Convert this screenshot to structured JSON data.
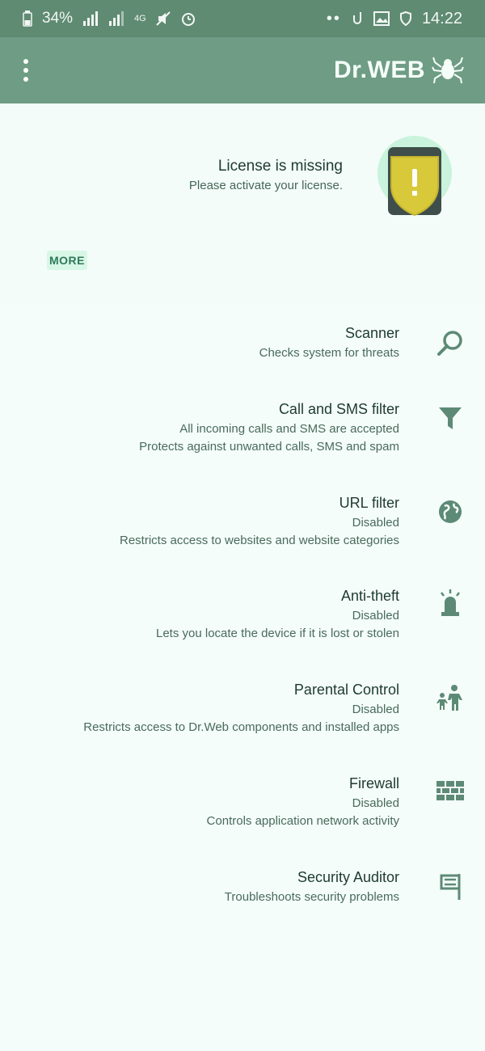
{
  "status_bar": {
    "time": "14:22",
    "battery": "34%",
    "network": "4G"
  },
  "app_bar": {
    "brand": "Dr.WEB"
  },
  "license": {
    "title": "License is missing",
    "subtitle": "Please activate your license.",
    "more_label": "MORE"
  },
  "features": [
    {
      "title": "Scanner",
      "lines": [
        "Checks system for threats"
      ],
      "icon": "search-icon"
    },
    {
      "title": "Call and SMS filter",
      "lines": [
        "All incoming calls and SMS are accepted",
        "Protects against unwanted calls, SMS and spam"
      ],
      "icon": "filter-icon"
    },
    {
      "title": "URL filter",
      "lines": [
        "Disabled",
        "Restricts access to websites and website categories"
      ],
      "icon": "globe-icon"
    },
    {
      "title": "Anti-theft",
      "lines": [
        "Disabled",
        "Lets you locate the device if it is lost or stolen"
      ],
      "icon": "alarm-beacon-icon"
    },
    {
      "title": "Parental Control",
      "lines": [
        "Disabled",
        "Restricts access to Dr.Web components and installed apps"
      ],
      "icon": "parent-child-icon"
    },
    {
      "title": "Firewall",
      "lines": [
        "Disabled",
        "Controls application network activity"
      ],
      "icon": "brick-wall-icon"
    },
    {
      "title": "Security Auditor",
      "lines": [
        "Troubleshoots security problems"
      ],
      "icon": "flag-icon"
    }
  ],
  "colors": {
    "status_bar": "#5f8b72",
    "app_bar": "#6f9c84",
    "icon": "#5d8a76",
    "shield": "#d8c93a"
  }
}
